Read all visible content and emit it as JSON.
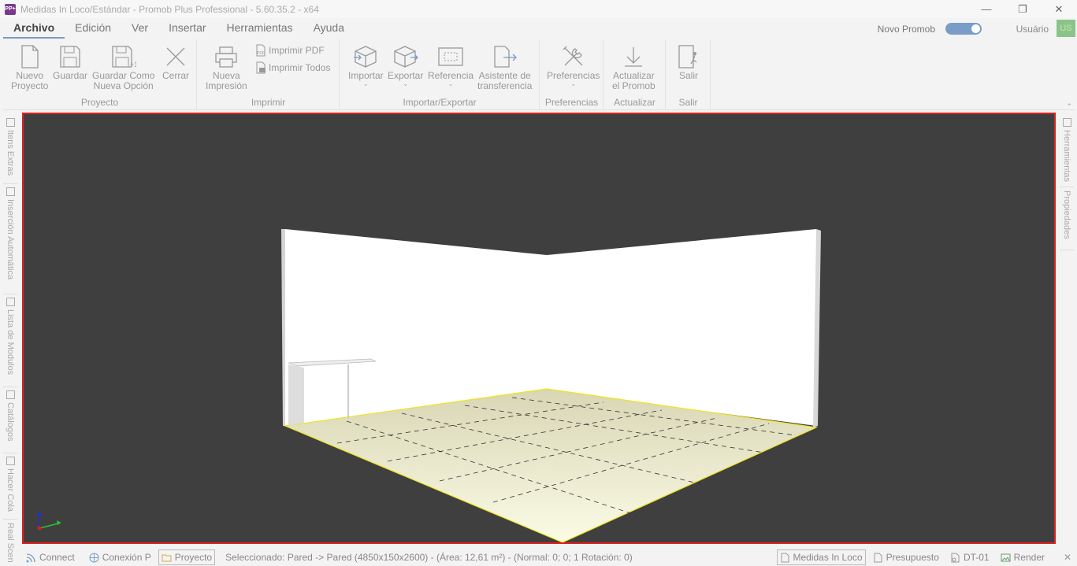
{
  "window": {
    "title": "Medidas In Loco/Estándar - Promob Plus Professional - 5.60.35.2 - x64",
    "app_icon_text": "PP+",
    "minimize": "—",
    "restore": "❐",
    "close": "✕"
  },
  "menu": {
    "items": [
      "Archivo",
      "Edición",
      "Ver",
      "Insertar",
      "Herramientas",
      "Ayuda"
    ],
    "novo_promob_label": "Novo Promob",
    "user_label": "Usuário",
    "avatar_text": "US"
  },
  "ribbon": {
    "groups": {
      "proyecto": "Proyecto",
      "imprimir": "Imprimir",
      "importar_exportar": "Importar/Exportar",
      "preferencias": "Preferencias",
      "actualizar": "Actualizar",
      "salir": "Salir"
    },
    "buttons": {
      "nuevo_proyecto_1": "Nuevo",
      "nuevo_proyecto_2": "Proyecto",
      "guardar": "Guardar",
      "guardar_como_1": "Guardar Como",
      "guardar_como_2": "Nueva Opción",
      "cerrar": "Cerrar",
      "nueva_impresion_1": "Nueva",
      "nueva_impresion_2": "Impresión",
      "imprimir_pdf": "Imprimir PDF",
      "imprimir_todos": "Imprimir Todos",
      "importar": "Importar",
      "exportar": "Exportar",
      "referencia": "Referencia",
      "asistente_1": "Asistente de",
      "asistente_2": "transferencia",
      "preferencias": "Preferencias",
      "actualizar_1": "Actualizar",
      "actualizar_2": "el Promob",
      "salir": "Salir"
    }
  },
  "left_tabs": [
    "Itens Extras",
    "Inserción Automática",
    "Lista de Modulos",
    "Catálogos",
    "Hacer Cola",
    "Real Scen"
  ],
  "right_tabs": [
    "Herramientas",
    "Propiedades"
  ],
  "status": {
    "connect": "Connect",
    "conexion": "Conexión P",
    "proyecto": "Proyecto",
    "seleccionado": "Seleccionado: Pared -> Pared (4850x150x2600) - (Área: 12,61 m²) - (Normal: 0; 0; 1 Rotación: 0)",
    "medidas": "Medidas In Loco",
    "presupuesto": "Presupuesto",
    "dt01": "DT-01",
    "render": "Render",
    "close": "✕"
  },
  "colors": {
    "viewport_bg": "#3f3f3f",
    "viewport_border": "#e02020",
    "wall": "#ffffff",
    "floor": "#f4f3d8",
    "floor_edge": "#f1e41e"
  }
}
